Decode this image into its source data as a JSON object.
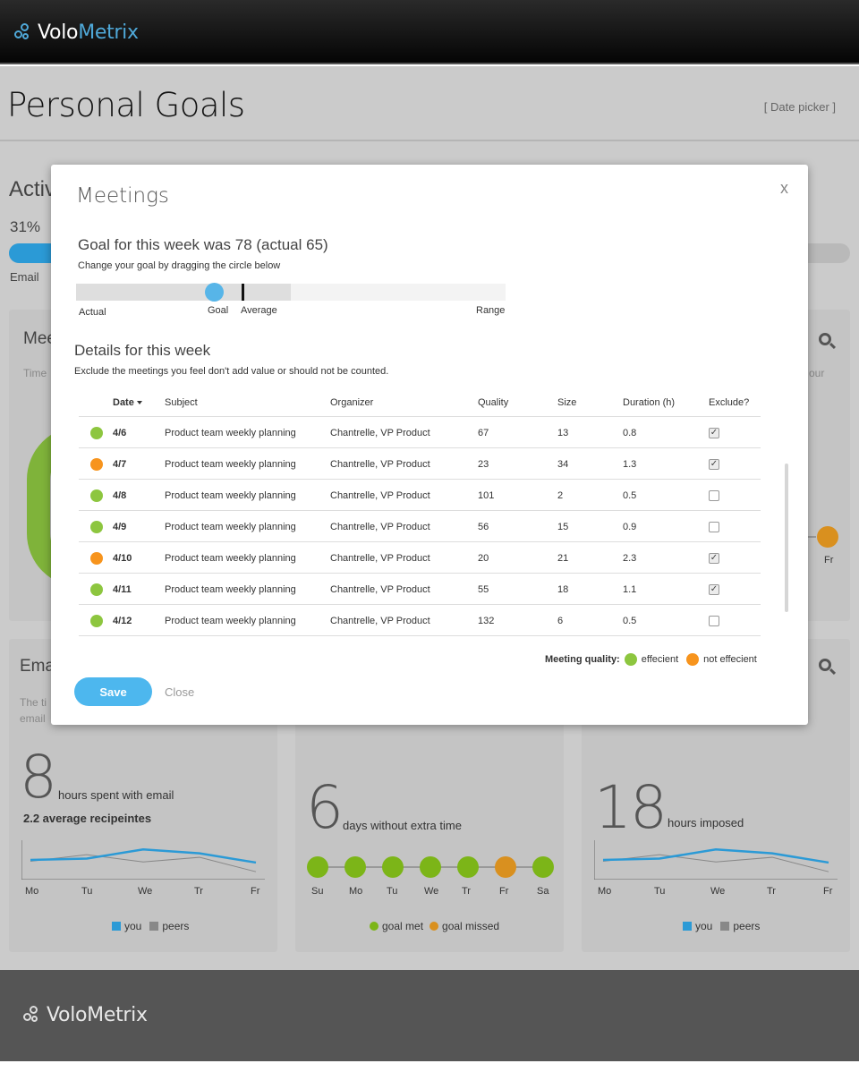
{
  "app": {
    "logo_part1": "Volo",
    "logo_part2": "Metrix",
    "footer_logo": "VoloMetrix"
  },
  "page": {
    "title": "Personal Goals",
    "date_picker": "[ Date picker ]"
  },
  "background": {
    "section_title": "Activ",
    "percent": "31%",
    "progress_fraction": 0.31,
    "bar_label": "Email",
    "meetings_card": {
      "title": "Mee",
      "subtitle": "Time",
      "right_text": "our",
      "day_label": "Fr"
    },
    "email_card": {
      "title": "Ema",
      "subtitle_line1": "The ti",
      "subtitle_line2": "email",
      "big_number": "8",
      "unit": "hours spent with email",
      "sub_stat": "2.2 average recipeintes",
      "days": [
        "Mo",
        "Tu",
        "We",
        "Tr",
        "Fr"
      ],
      "you": [
        3,
        3.2,
        4.6,
        4,
        2.6
      ],
      "peers": [
        2.8,
        3.8,
        2.7,
        3.4,
        1.2
      ],
      "legend_you": "you",
      "legend_peers": "peers"
    },
    "extra_time_card": {
      "big_number": "6",
      "unit": "days without extra time",
      "days": [
        "Su",
        "Mo",
        "Tu",
        "We",
        "Tr",
        "Fr",
        "Sa"
      ],
      "status": [
        "met",
        "met",
        "met",
        "met",
        "met",
        "missed",
        "met"
      ],
      "legend_met": "goal met",
      "legend_missed": "goal missed"
    },
    "imposed_card": {
      "big_number": "18",
      "unit": "hours imposed",
      "days": [
        "Mo",
        "Tu",
        "We",
        "Tr",
        "Fr"
      ],
      "you": [
        3,
        3.2,
        4.6,
        4,
        2.6
      ],
      "peers": [
        2.8,
        3.8,
        2.7,
        3.4,
        1.2
      ],
      "legend_you": "you",
      "legend_peers": "peers"
    }
  },
  "modal": {
    "title": "Meetings",
    "close_glyph": "x",
    "goal_line": "Goal  for this week was 78 (actual 65)",
    "goal_hint": "Change your goal by dragging the circle below",
    "range": {
      "labels": {
        "actual": "Actual",
        "goal": "Goal",
        "average": "Average",
        "range": "Range"
      },
      "goal_fraction": 0.32,
      "average_fraction": 0.385,
      "shaded_fraction": 0.5
    },
    "details_title": "Details for this week",
    "details_hint": "Exclude the meetings you feel don't add value or should not be counted.",
    "columns": [
      "Date",
      "Subject",
      "Organizer",
      "Quality",
      "Size",
      "Duration (h)",
      "Exclude?"
    ],
    "rows": [
      {
        "quality_status": "efficient",
        "date": "4/6",
        "subject": "Product team weekly planning",
        "organizer": "Chantrelle, VP Product",
        "quality": "67",
        "size": "13",
        "duration": "0.8",
        "exclude": true
      },
      {
        "quality_status": "not-efficient",
        "date": "4/7",
        "subject": "Product team weekly planning",
        "organizer": "Chantrelle, VP Product",
        "quality": "23",
        "size": "34",
        "duration": "1.3",
        "exclude": true
      },
      {
        "quality_status": "efficient",
        "date": "4/8",
        "subject": "Product team weekly planning",
        "organizer": "Chantrelle, VP Product",
        "quality": "101",
        "size": "2",
        "duration": "0.5",
        "exclude": false
      },
      {
        "quality_status": "efficient",
        "date": "4/9",
        "subject": "Product team weekly planning",
        "organizer": "Chantrelle, VP Product",
        "quality": "56",
        "size": "15",
        "duration": "0.9",
        "exclude": false
      },
      {
        "quality_status": "not-efficient",
        "date": "4/10",
        "subject": "Product team weekly planning",
        "organizer": "Chantrelle, VP Product",
        "quality": "20",
        "size": "21",
        "duration": "2.3",
        "exclude": true
      },
      {
        "quality_status": "efficient",
        "date": "4/11",
        "subject": "Product team weekly planning",
        "organizer": "Chantrelle, VP Product",
        "quality": "55",
        "size": "18",
        "duration": "1.1",
        "exclude": true
      },
      {
        "quality_status": "efficient",
        "date": "4/12",
        "subject": "Product team weekly planning",
        "organizer": "Chantrelle, VP Product",
        "quality": "132",
        "size": "6",
        "duration": "0.5",
        "exclude": false
      }
    ],
    "quality_legend": {
      "label": "Meeting quality:",
      "efficient": "effecient",
      "not_efficient": "not effecient"
    },
    "save_label": "Save",
    "close_label": "Close"
  },
  "colors": {
    "efficient": "#8dc63f",
    "not_efficient": "#f7941d",
    "accent": "#4db7ee",
    "you_line": "#2b9ad6",
    "peers_line": "#888888",
    "goal_met": "#7cb518",
    "goal_missed": "#d9901f"
  }
}
